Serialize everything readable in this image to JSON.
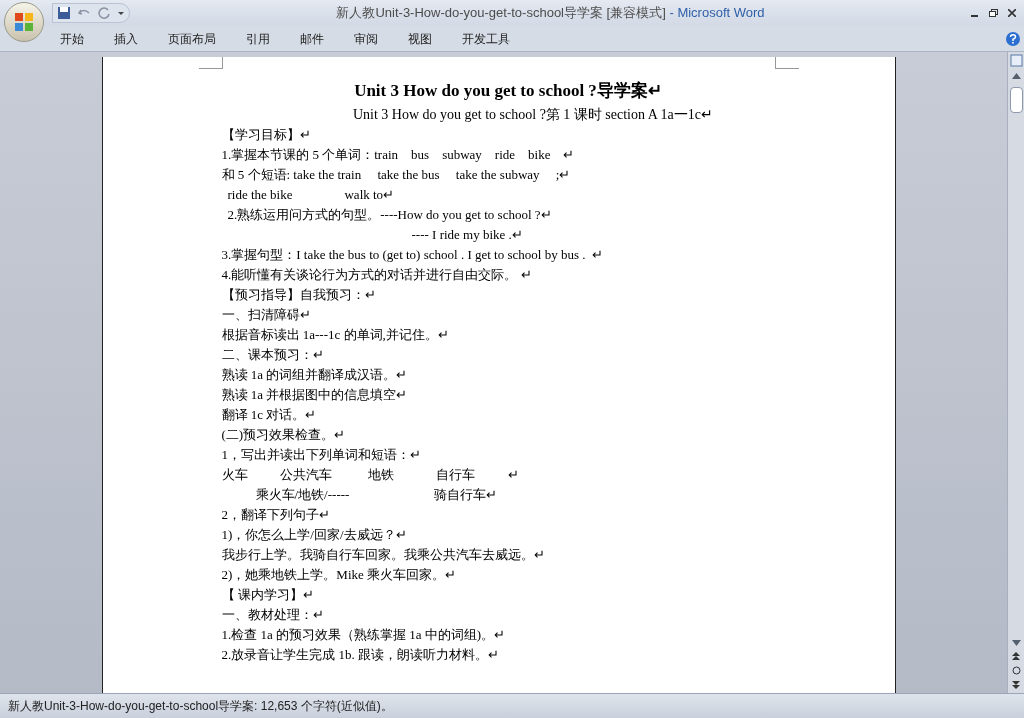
{
  "window": {
    "title": "新人教Unit-3-How-do-you-get-to-school导学案 [兼容模式]",
    "app_name": " - Microsoft Word"
  },
  "ribbon_tabs": [
    {
      "label": "开始",
      "selected": false
    },
    {
      "label": "插入",
      "selected": false
    },
    {
      "label": "页面布局",
      "selected": false
    },
    {
      "label": "引用",
      "selected": false
    },
    {
      "label": "邮件",
      "selected": false
    },
    {
      "label": "审阅",
      "selected": false
    },
    {
      "label": "视图",
      "selected": false
    },
    {
      "label": "开发工具",
      "selected": false
    }
  ],
  "document": {
    "lines": [
      {
        "kind": "title",
        "text": "Unit 3 How do you get to school ?导学案↵"
      },
      {
        "kind": "subtitle",
        "text": "Unit 3 How do you get to school ?第 1 课时 section A 1a一1c↵"
      },
      {
        "kind": "plain",
        "text": "【学习目标】↵"
      },
      {
        "kind": "plain",
        "text": "1.掌握本节课的 5 个单词：train    bus    subway    ride    bike    ↵"
      },
      {
        "kind": "plain",
        "text": "和 5 个短语: take the train     take the bus     take the subway     ;↵"
      },
      {
        "kind": "indent",
        "text": "ride the bike                walk to↵"
      },
      {
        "kind": "indent",
        "text": "2.熟练运用问方式的句型。----How do you get to school ?↵"
      },
      {
        "kind": "answer",
        "text": "---- I ride my bike .↵"
      },
      {
        "kind": "plain",
        "text": "3.掌握句型：I take the bus to (get to) school . I get to school by bus .  ↵"
      },
      {
        "kind": "plain",
        "text": "4.能听懂有关谈论行为方式的对话并进行自由交际。 ↵"
      },
      {
        "kind": "plain",
        "text": "【预习指导】自我预习：↵"
      },
      {
        "kind": "plain",
        "text": "一、扫清障碍↵"
      },
      {
        "kind": "plain",
        "text": "根据音标读出 1a---1c 的单词,并记住。↵"
      },
      {
        "kind": "plain",
        "text": "二、课本预习：↵"
      },
      {
        "kind": "plain",
        "text": "熟读 1a 的词组并翻译成汉语。↵"
      },
      {
        "kind": "plain",
        "text": "熟读 1a 并根据图中的信息填空↵"
      },
      {
        "kind": "plain",
        "text": "翻译 1c 对话。↵"
      },
      {
        "kind": "plain",
        "text": "(二)预习效果检查。↵"
      },
      {
        "kind": "plain",
        "text": "1，写出并读出下列单词和短语：↵"
      },
      {
        "kind": "plain",
        "text": "火车          公共汽车           地铁             自行车          ↵"
      },
      {
        "kind": "wide-indent",
        "text": "乘火车/地铁/-----                          骑自行车↵"
      },
      {
        "kind": "plain",
        "text": "2，翻译下列句子↵"
      },
      {
        "kind": "plain",
        "text": "1)，你怎么上学/回家/去威远？↵"
      },
      {
        "kind": "plain",
        "text": "我步行上学。我骑自行车回家。我乘公共汽车去威远。↵"
      },
      {
        "kind": "plain",
        "text": "2)，她乘地铁上学。Mike 乘火车回家。↵"
      },
      {
        "kind": "plain",
        "text": "【 课内学习】↵"
      },
      {
        "kind": "plain",
        "text": "一、教材处理：↵"
      },
      {
        "kind": "plain",
        "text": "1.检查 1a 的预习效果（熟练掌握 1a 中的词组)。↵"
      },
      {
        "kind": "plain",
        "text": "2.放录音让学生完成 1b. 跟读，朗读听力材料。↵"
      }
    ]
  },
  "status_bar": {
    "text": "新人教Unit-3-How-do-you-get-to-school导学案: 12,653 个字符(近似值)。"
  }
}
